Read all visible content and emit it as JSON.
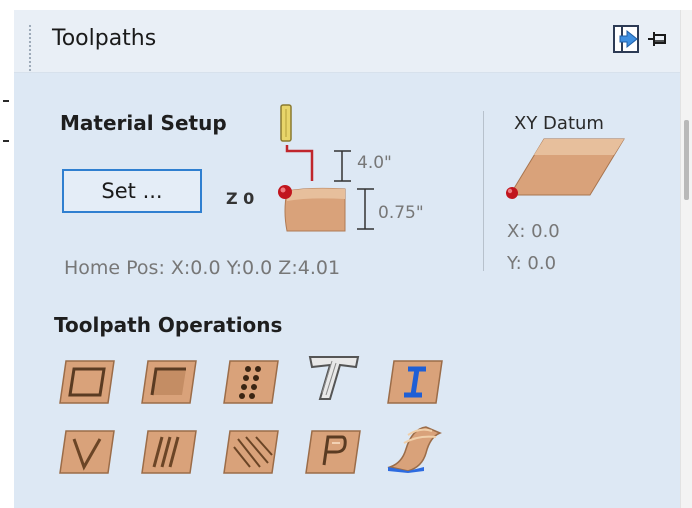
{
  "panel": {
    "title": "Toolpaths",
    "pin_icon": "pin-icon",
    "dock_icon": "dock-panel-icon"
  },
  "material_setup": {
    "heading": "Material Setup",
    "set_button": "Set ...",
    "z_label": "Z 0",
    "clearance": "4.0\"",
    "thickness": "0.75\"",
    "home_pos": "Home Pos:  X:0.0 Y:0.0 Z:4.01"
  },
  "xy_datum": {
    "heading": "XY Datum",
    "x": "X: 0.0",
    "y": "Y: 0.0"
  },
  "operations": {
    "heading": "Toolpath Operations",
    "icons": [
      "profile-toolpath-icon",
      "pocket-toolpath-icon",
      "drilling-toolpath-icon",
      "texture-text-icon",
      "inlay-toolpath-icon",
      "v-carve-toolpath-icon",
      "fluting-toolpath-icon",
      "texture-toolpath-icon",
      "prism-carve-icon",
      "moulding-toolpath-icon"
    ]
  },
  "colors": {
    "panel_bg": "#dde8f4",
    "title_bg": "#e9eff6",
    "button_border": "#2f7fd0",
    "wood": "#d9a27a"
  }
}
